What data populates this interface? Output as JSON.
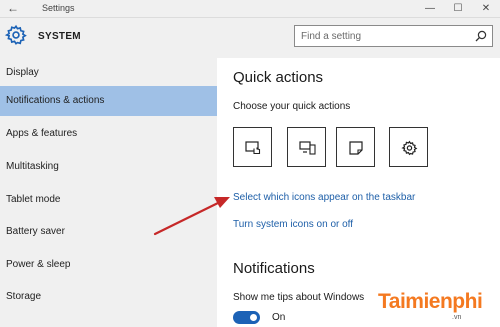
{
  "window": {
    "title": "Settings",
    "controls": [
      "minimize",
      "maximize",
      "close"
    ]
  },
  "header": {
    "section_title": "SYSTEM",
    "search_placeholder": "Find a setting"
  },
  "sidebar": {
    "items": [
      {
        "label": "Display",
        "active": false
      },
      {
        "label": "Notifications & actions",
        "active": true
      },
      {
        "label": "Apps & features",
        "active": false
      },
      {
        "label": "Multitasking",
        "active": false
      },
      {
        "label": "Tablet mode",
        "active": false
      },
      {
        "label": "Battery saver",
        "active": false
      },
      {
        "label": "Power & sleep",
        "active": false
      },
      {
        "label": "Storage",
        "active": false
      }
    ]
  },
  "main": {
    "quick_actions_heading": "Quick actions",
    "quick_actions_sub": "Choose your quick actions",
    "quick_action_icons": [
      "tablet-mode-icon",
      "project-icon",
      "note-icon",
      "settings-icon"
    ],
    "link_taskbar_icons": "Select which icons appear on the taskbar",
    "link_system_icons": "Turn system icons on or off",
    "notifications_heading": "Notifications",
    "tips_label": "Show me tips about Windows",
    "tips_toggle": {
      "state": "On",
      "on": true
    }
  },
  "watermark": {
    "brand": "Taimienphi",
    "domain": ".vn"
  },
  "colors": {
    "accent": "#1c62b6",
    "active_item": "#9fc0e6",
    "link": "#1e5fa8",
    "sidebar_bg": "#f0f0f0",
    "arrow": "#c62828",
    "watermark": "#f47920"
  }
}
